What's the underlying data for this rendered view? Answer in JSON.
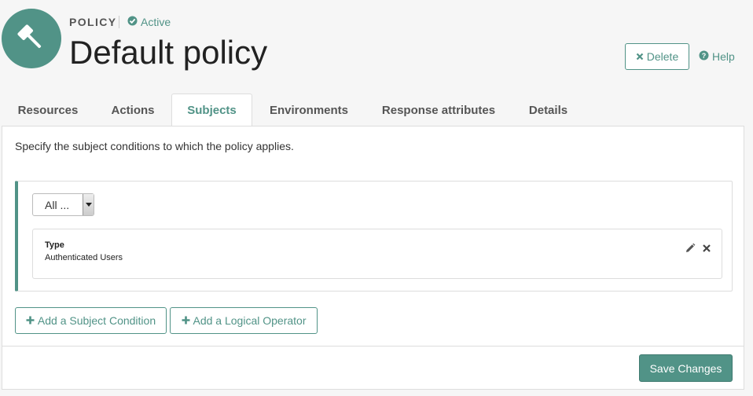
{
  "header": {
    "type_label": "POLICY",
    "status_label": "Active",
    "title": "Default policy",
    "icon": "gavel-icon",
    "delete_label": "Delete",
    "help_label": "Help"
  },
  "tabs": [
    {
      "label": "Resources",
      "active": false
    },
    {
      "label": "Actions",
      "active": false
    },
    {
      "label": "Subjects",
      "active": true
    },
    {
      "label": "Environments",
      "active": false
    },
    {
      "label": "Response attributes",
      "active": false
    },
    {
      "label": "Details",
      "active": false
    }
  ],
  "panel": {
    "description": "Specify the subject conditions to which the policy applies.",
    "operator_select": {
      "value": "All ..."
    },
    "conditions": [
      {
        "key_label": "Type",
        "value": "Authenticated Users"
      }
    ],
    "add_condition_label": "Add a Subject Condition",
    "add_operator_label": "Add a Logical Operator",
    "save_label": "Save Changes"
  },
  "colors": {
    "accent": "#519387",
    "background": "#f6f6f6",
    "panel": "#ffffff",
    "border": "#dddddd"
  }
}
